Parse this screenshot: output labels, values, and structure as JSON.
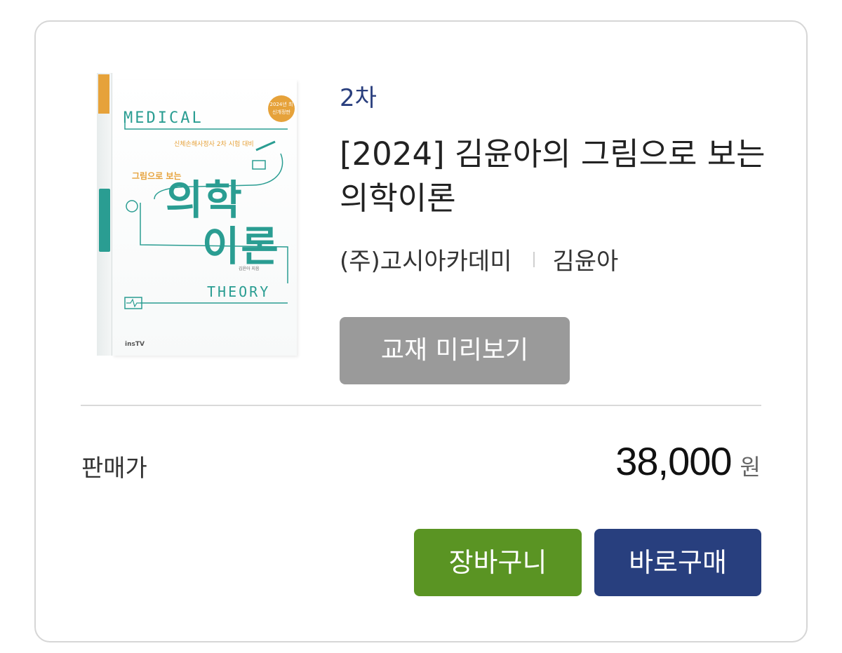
{
  "book": {
    "category": "2차",
    "title": "[2024] 김윤아의 그림으로 보는 의학이론",
    "publisher": "(주)고시아카데미",
    "author": "김윤아",
    "preview_label": "교재 미리보기",
    "cover": {
      "word_top": "MEDICAL",
      "word_bottom": "THEORY",
      "badge": "2024년 최신개정판",
      "subtitle": "신체손해사정사 2차 시험 대비",
      "small_title": "그림으로 보는",
      "main_title_line1": "의학",
      "main_title_line2": "이론",
      "author_line": "김윤아 지음",
      "publisher_mark": "insTV",
      "accent_color": "#2a9d92",
      "badge_color": "#e6a23a"
    }
  },
  "price": {
    "label": "판매가",
    "value": "38,000",
    "unit": "원"
  },
  "actions": {
    "cart_label": "장바구니",
    "buy_label": "바로구매",
    "cart_color": "#5a9423",
    "buy_color": "#283f7e"
  }
}
